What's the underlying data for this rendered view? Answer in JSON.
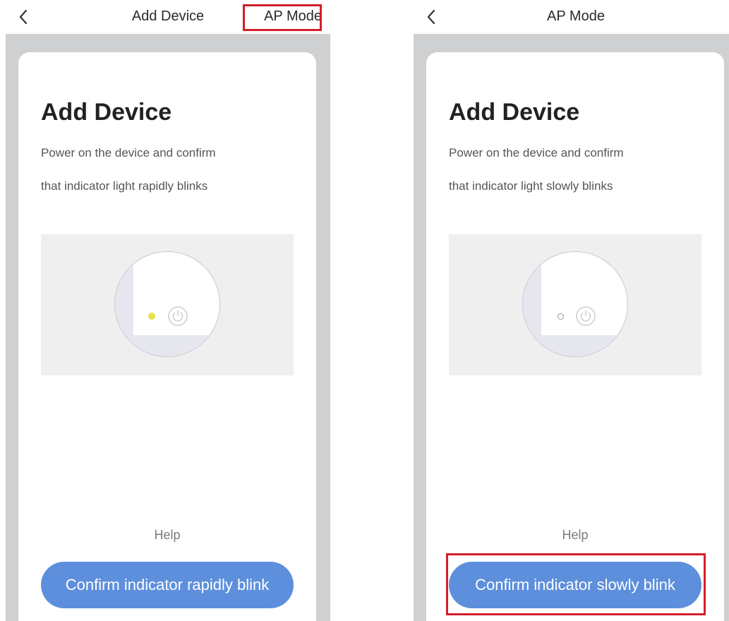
{
  "screens": [
    {
      "nav": {
        "title": "Add Device",
        "action": "AP Mode"
      },
      "card": {
        "title": "Add Device",
        "line1": "Power on the device and confirm",
        "line2": "that indicator light rapidly blinks",
        "help": "Help",
        "confirm": "Confirm indicator rapidly blink"
      }
    },
    {
      "nav": {
        "title": "AP Mode"
      },
      "card": {
        "title": "Add Device",
        "line1": "Power on the device and confirm",
        "line2": "that indicator light slowly blinks",
        "help": "Help",
        "confirm": "Confirm indicator slowly blink"
      }
    }
  ],
  "colors": {
    "accent_button": "#5d8fdc",
    "highlight": "#d21f2b",
    "indicator_on": "#e8e04a",
    "backdrop": "#cfd0d1"
  },
  "icons": [
    "chevron-left-icon",
    "power-icon"
  ]
}
